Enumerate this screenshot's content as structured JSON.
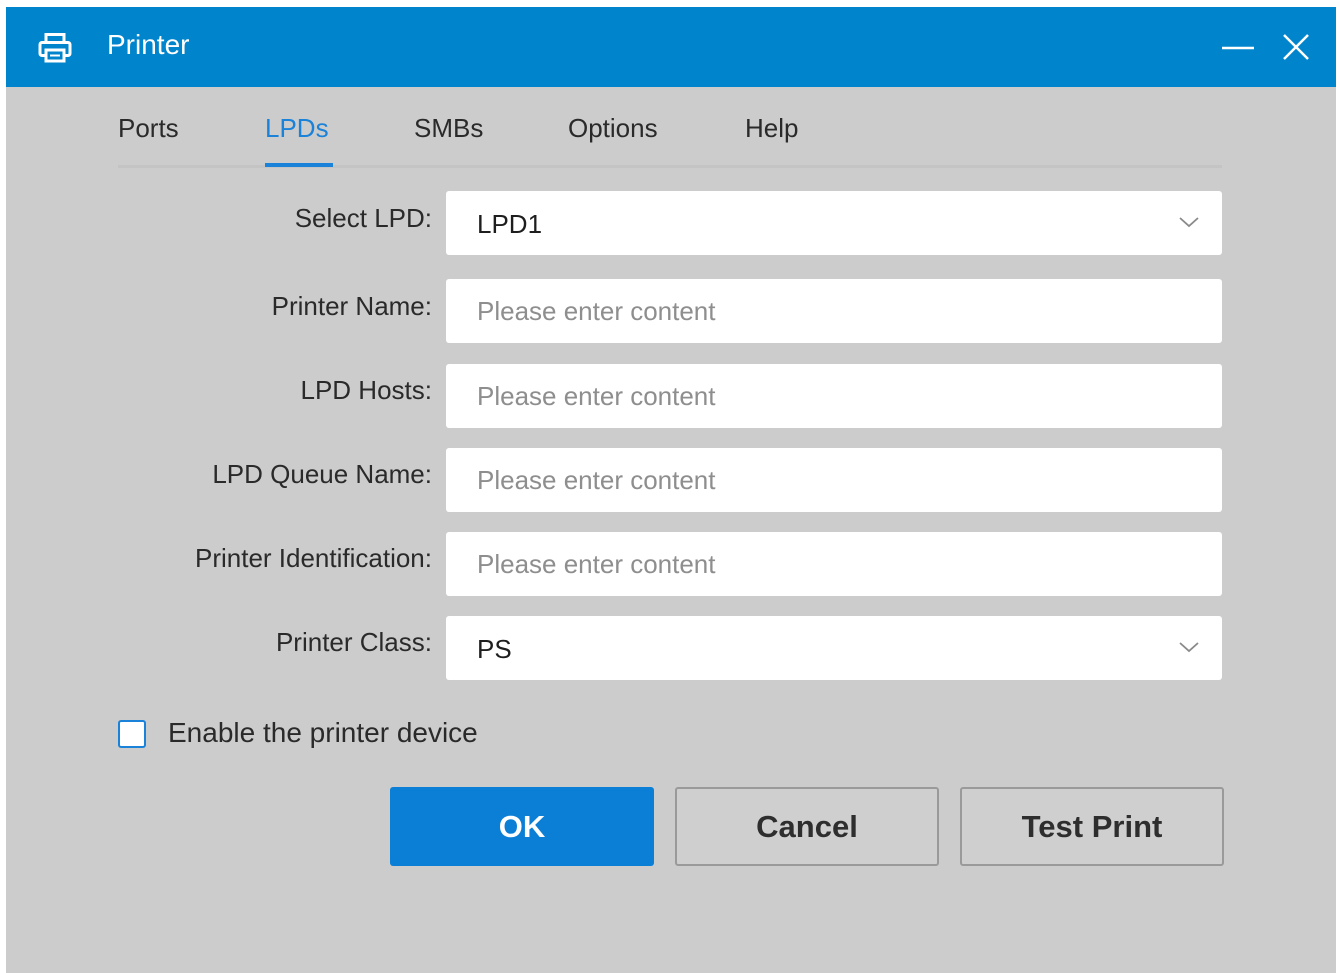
{
  "window": {
    "title": "Printer",
    "icon": "printer-icon",
    "controls": [
      "minimize-icon",
      "close-icon"
    ],
    "titlebar_color": "#0084cc"
  },
  "tabs": {
    "items": [
      {
        "label": "Ports"
      },
      {
        "label": "LPDs"
      },
      {
        "label": "SMBs"
      },
      {
        "label": "Options"
      },
      {
        "label": "Help"
      }
    ],
    "active": "LPDs",
    "accent_color": "#1a82d8"
  },
  "form": {
    "select_lpd": {
      "label": "Select LPD:",
      "value": "LPD1"
    },
    "printer_name": {
      "label": "Printer Name:",
      "placeholder": "Please enter content",
      "value": ""
    },
    "lpd_hosts": {
      "label": "LPD Hosts:",
      "placeholder": "Please enter content",
      "value": ""
    },
    "lpd_queue_name": {
      "label": "LPD Queue Name:",
      "placeholder": "Please enter content",
      "value": ""
    },
    "printer_identification": {
      "label": "Printer Identification:",
      "placeholder": "Please enter content",
      "value": ""
    },
    "printer_class": {
      "label": "Printer Class:",
      "value": "PS"
    }
  },
  "enable_device": {
    "label": "Enable the printer device",
    "checked": false
  },
  "buttons": {
    "ok": "OK",
    "cancel": "Cancel",
    "test_print": "Test Print"
  }
}
